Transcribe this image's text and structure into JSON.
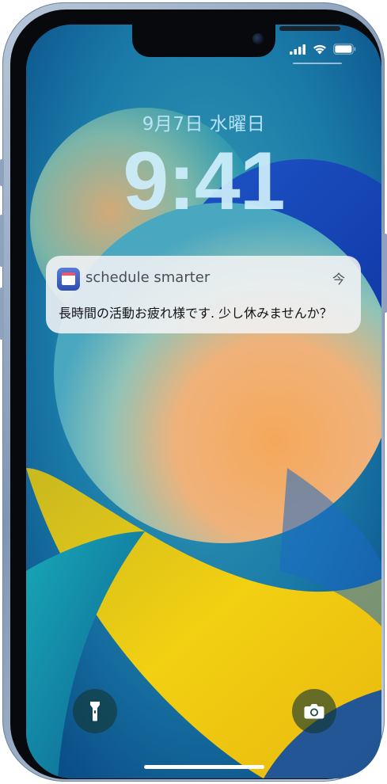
{
  "status_bar": {
    "signal_icon": "cellular-signal-icon",
    "wifi_icon": "wifi-icon",
    "battery_icon": "battery-icon"
  },
  "lock_screen": {
    "date": "9月7日 水曜日",
    "time": "9:41"
  },
  "notification": {
    "app_icon": "schedule-app-icon",
    "app_name": "schedule smarter",
    "timestamp": "今",
    "message": "長時間の活動お疲れ様です. 少し休みませんか？"
  },
  "quick_actions": {
    "flashlight_icon": "flashlight-icon",
    "camera_icon": "camera-icon"
  },
  "colors": {
    "frame": "#8ea2bd",
    "clock_text": "#cdeefc",
    "notification_bg": "#f2f2f5"
  }
}
